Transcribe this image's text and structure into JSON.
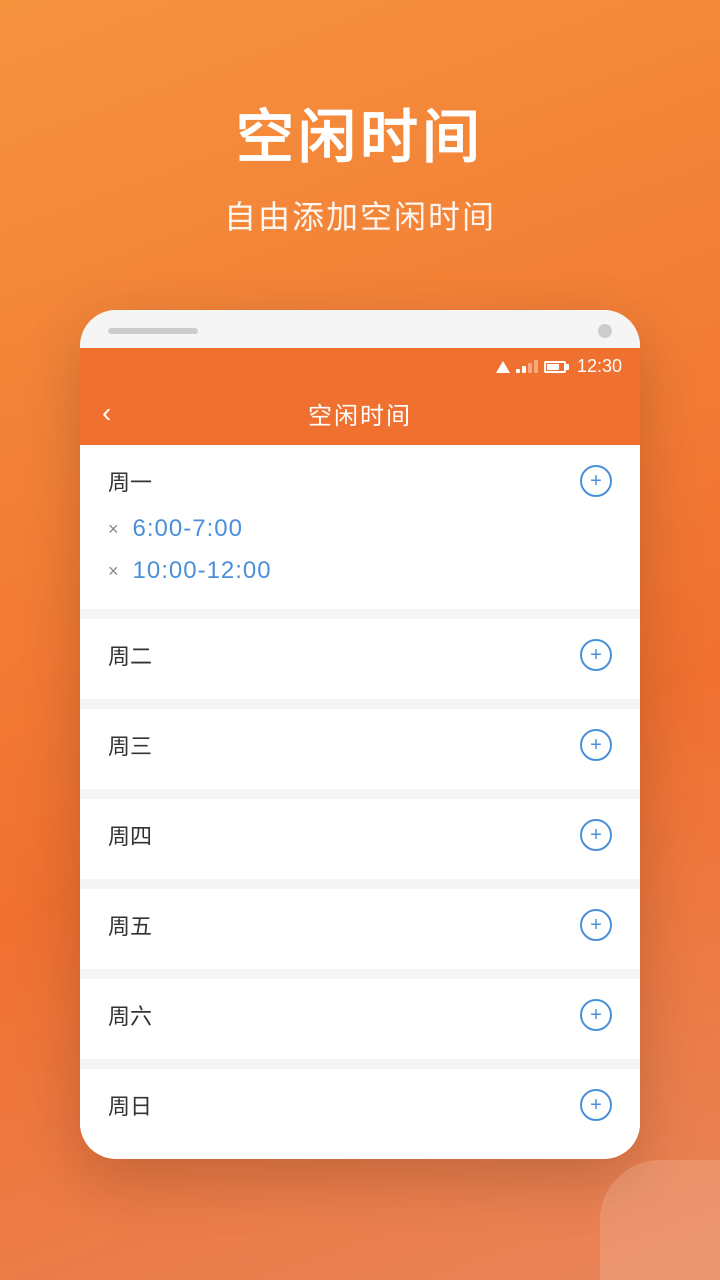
{
  "background": {
    "gradient_start": "#f5923e",
    "gradient_end": "#e8855a"
  },
  "header": {
    "main_title": "空闲时间",
    "sub_title": "自由添加空闲时间"
  },
  "status_bar": {
    "time": "12:30"
  },
  "app_bar": {
    "back_label": "‹",
    "title": "空闲时间"
  },
  "days": [
    {
      "id": "monday",
      "label": "周一",
      "slots": [
        {
          "id": "slot1",
          "range": "6:00-7:00"
        },
        {
          "id": "slot2",
          "range": "10:00-12:00"
        }
      ]
    },
    {
      "id": "tuesday",
      "label": "周二",
      "slots": []
    },
    {
      "id": "wednesday",
      "label": "周三",
      "slots": []
    },
    {
      "id": "thursday",
      "label": "周四",
      "slots": []
    },
    {
      "id": "friday",
      "label": "周五",
      "slots": []
    },
    {
      "id": "saturday",
      "label": "周六",
      "slots": []
    },
    {
      "id": "sunday",
      "label": "周日",
      "slots": []
    }
  ],
  "add_btn_label": "+",
  "remove_btn_label": "×"
}
